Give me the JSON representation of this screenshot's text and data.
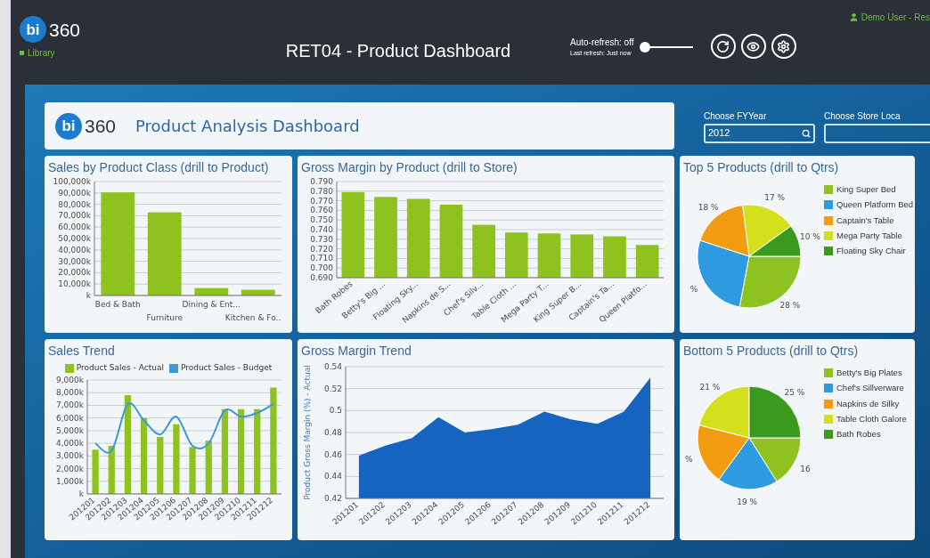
{
  "header": {
    "logo": {
      "mark": "bi",
      "text": "360"
    },
    "library_link": "Library",
    "title": "RET04 - Product Dashboard",
    "auto_refresh": {
      "label": "Auto-refresh: off",
      "on": false,
      "last_refresh": "Last refresh: Just now"
    },
    "user": "Demo User - Res"
  },
  "dashboard": {
    "logo": {
      "mark": "bi",
      "text": "360"
    },
    "title": "Product Analysis Dashboard"
  },
  "filters": [
    {
      "label": "Choose FYYear",
      "value": "2012",
      "kind": "search"
    },
    {
      "label": "Choose Store Loca",
      "kind": "text"
    }
  ],
  "panels": [
    {
      "chart_data": {
        "type": "bar",
        "grid": true,
        "title": "Sales by Product Class (drill to Product)",
        "categories": [
          "Bed & Bath",
          "Furniture",
          "Dining & Ent...",
          "Kitchen & Fo.."
        ],
        "series": [
          {
            "color": "#8dc21f",
            "values": [
              90500,
              73000,
              6500,
              5000
            ]
          }
        ],
        "ylim": [
          0,
          100000
        ],
        "yticks": [
          {
            "value": 0,
            "label": "k"
          },
          {
            "value": 10000,
            "label": "10,000k"
          },
          {
            "value": 20000,
            "label": "20,000k"
          },
          {
            "value": 30000,
            "label": "30,000k"
          },
          {
            "value": 40000,
            "label": "40,000k"
          },
          {
            "value": 50000,
            "label": "50,000k"
          },
          {
            "value": 60000,
            "label": "60,000k"
          },
          {
            "value": 70000,
            "label": "70,000k"
          },
          {
            "value": 80000,
            "label": "80,000k"
          },
          {
            "value": 90000,
            "label": "90,000k"
          },
          {
            "value": 100000,
            "label": "100,000k"
          }
        ]
      }
    },
    {
      "chart_data": {
        "type": "bar",
        "grid": true,
        "title": "Gross Margin by Product (drill to Store)",
        "categories": [
          "Bath Robes",
          "Betty's Big ...",
          "Floating Sky...",
          "Napkins de S...",
          "Chef's Silv...",
          "Table Cloth ...",
          "Mega Party T...",
          "King Super B...",
          "Captain's Ta...",
          "Queen Platfo..."
        ],
        "series": [
          {
            "color": "#8dc21f",
            "values": [
              0.779,
              0.774,
              0.772,
              0.766,
              0.745,
              0.737,
              0.736,
              0.735,
              0.733,
              0.724
            ]
          }
        ],
        "ylim": [
          0.69,
          0.79
        ],
        "yticks": [
          {
            "value": 0.69,
            "label": "0.690"
          },
          {
            "value": 0.7,
            "label": "0.700"
          },
          {
            "value": 0.71,
            "label": "0.710"
          },
          {
            "value": 0.72,
            "label": "0.720"
          },
          {
            "value": 0.73,
            "label": "0.730"
          },
          {
            "value": 0.74,
            "label": "0.740"
          },
          {
            "value": 0.75,
            "label": "0.750"
          },
          {
            "value": 0.76,
            "label": "0.760"
          },
          {
            "value": 0.77,
            "label": "0.770"
          },
          {
            "value": 0.78,
            "label": "0.780"
          },
          {
            "value": 0.79,
            "label": "0.790"
          }
        ]
      }
    },
    {
      "chart_data": {
        "type": "pie",
        "title": "Top 5 Products (drill to Qtrs)",
        "categories": [
          "King Super Bed",
          "Queen Platform Bed",
          "Captain's Table",
          "Mega Party Table",
          "Floating Sky Chair"
        ],
        "values": [
          28,
          27,
          18,
          17,
          10
        ],
        "colors": [
          "#8dc21f",
          "#2e9be0",
          "#f39c12",
          "#d4e01c",
          "#3a9a1e"
        ],
        "value_labels": [
          "28 %",
          "%",
          "18 %",
          "17 %",
          "10 %"
        ]
      }
    },
    {
      "chart_data": {
        "type": "bar",
        "grid": true,
        "title": "Sales Trend",
        "categories": [
          "201201",
          "201202",
          "201203",
          "201204",
          "201205",
          "201206",
          "201207",
          "201208",
          "201209",
          "201210",
          "201211",
          "201212"
        ],
        "series": [
          {
            "name": "Product Sales - Actual",
            "type": "bar",
            "color": "#8dc21f",
            "values": [
              3500,
              3800,
              7800,
              6000,
              4500,
              5500,
              3700,
              4200,
              6700,
              6700,
              6700,
              8400
            ]
          },
          {
            "name": "Product Sales - Budget",
            "type": "line",
            "color": "#3a9ad9",
            "values": [
              4000,
              3400,
              7100,
              5800,
              4700,
              6100,
              3800,
              4000,
              6600,
              6100,
              6400,
              7100
            ]
          }
        ],
        "ylim": [
          0,
          9000
        ],
        "yticks": [
          {
            "value": 0,
            "label": "k"
          },
          {
            "value": 1000,
            "label": "1,000k"
          },
          {
            "value": 2000,
            "label": "2,000k"
          },
          {
            "value": 3000,
            "label": "3,000k"
          },
          {
            "value": 4000,
            "label": "4,000k"
          },
          {
            "value": 5000,
            "label": "5,000k"
          },
          {
            "value": 6000,
            "label": "6,000k"
          },
          {
            "value": 7000,
            "label": "7,000k"
          },
          {
            "value": 8000,
            "label": "8,000k"
          },
          {
            "value": 9000,
            "label": "9,000k"
          }
        ]
      }
    },
    {
      "chart_data": {
        "type": "area",
        "grid": true,
        "title": "Gross Margin Trend",
        "ylabel": "Product Gross Margin (%) - Actual",
        "categories": [
          "201201",
          "201202",
          "201203",
          "201204",
          "201205",
          "201206",
          "201207",
          "201208",
          "201209",
          "201210",
          "201211",
          "201212"
        ],
        "series": [
          {
            "color": "#1565c0",
            "values": [
              0.459,
              0.468,
              0.475,
              0.494,
              0.48,
              0.483,
              0.487,
              0.499,
              0.492,
              0.488,
              0.499,
              0.53
            ]
          }
        ],
        "ylim": [
          0.42,
          0.54
        ],
        "yticks": [
          0.42,
          0.44,
          0.46,
          0.48,
          0.5,
          0.52,
          0.54
        ]
      }
    },
    {
      "chart_data": {
        "type": "pie",
        "title": "Bottom 5 Products (drill to Qtrs)",
        "categories": [
          "Betty's Big Plates",
          "Chef's Sillverware",
          "Napkins de Silky",
          "Table Cloth Galore",
          "Bath Robes"
        ],
        "values": [
          16,
          19,
          19,
          21,
          25
        ],
        "colors": [
          "#8dc21f",
          "#2e9be0",
          "#f39c12",
          "#d4e01c",
          "#3a9a1e"
        ],
        "value_labels": [
          "16",
          "19 %",
          "%",
          "21 %",
          "25 %"
        ]
      }
    }
  ]
}
